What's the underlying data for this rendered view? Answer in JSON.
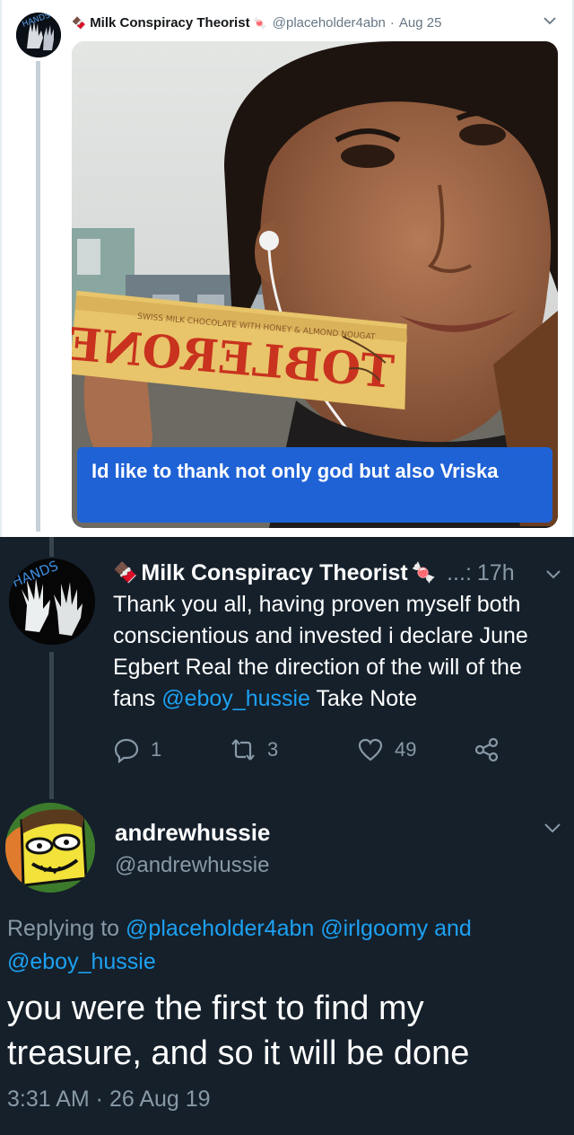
{
  "tweet1": {
    "name": "Milk Conspiracy Theorist",
    "handle": "@placeholder4abn",
    "date": "Aug 25",
    "separator": "·",
    "emoji_left": "chocolate-emoji",
    "emoji_right": "candy-emoji",
    "media_alt_caption": "Id like to thank not only god but also Vriska"
  },
  "tweet2": {
    "name": "Milk Conspiracy Theorist",
    "handle_fragment": "...:",
    "time": "17h",
    "text_before": "Thank you all, having proven myself both conscientious and invested i declare June Egbert Real the direction of the will of the fans ",
    "mention": "@eboy_hussie",
    "text_after": " Take Note",
    "reply_count": "1",
    "retweet_count": "3",
    "like_count": "49"
  },
  "reply": {
    "name": "andrewhussie",
    "handle": "@andrewhussie",
    "replying_label": "Replying to",
    "mention1": "@placeholder4abn",
    "mention2": "@irlgoomy",
    "and_word": "and",
    "mention3": "@eboy_hussie",
    "text": "you were the first to find my treasure, and so it will be done",
    "timestamp": "3:31 AM · 26 Aug 19"
  },
  "colors": {
    "dark_bg": "#15202b",
    "link_blue": "#1da1f2",
    "caption_blue": "#1f62d6",
    "muted_gray": "#8899a6"
  }
}
